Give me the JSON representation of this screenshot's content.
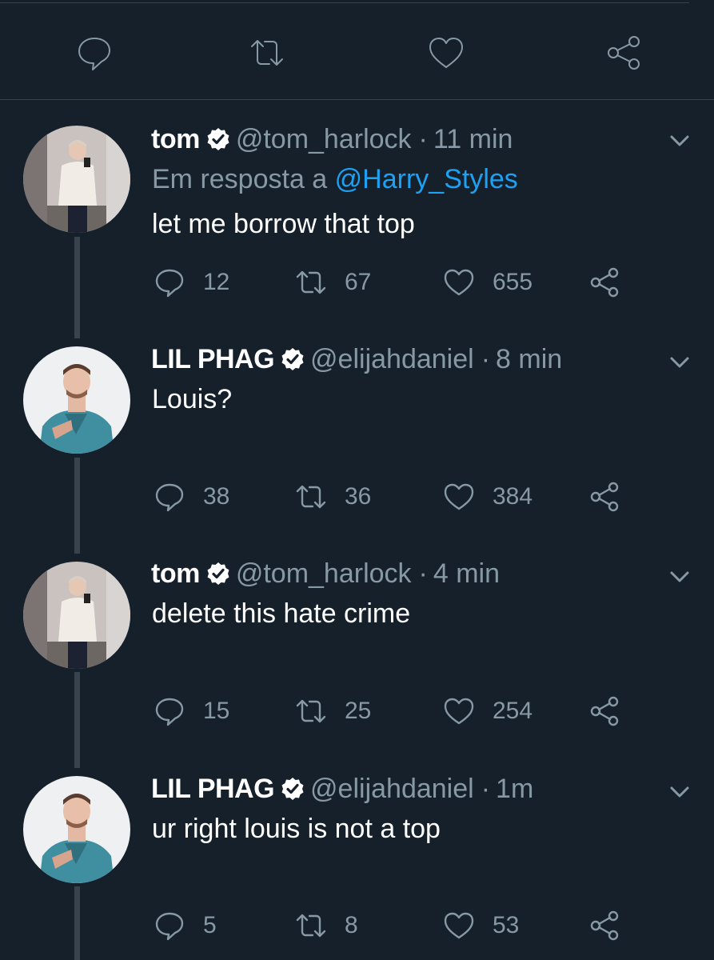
{
  "tweets": [
    {
      "name": "tom",
      "handle": "@tom_harlock",
      "separator": "·",
      "time": "11 min",
      "reply_prefix": "Em resposta a",
      "reply_to": "@Harry_Styles",
      "text": "let me borrow that top",
      "replies": "12",
      "retweets": "67",
      "likes": "655"
    },
    {
      "name": "LIL PHAG",
      "handle": "@elijahdaniel",
      "separator": "·",
      "time": "8 min",
      "text": "Louis?",
      "replies": "38",
      "retweets": "36",
      "likes": "384"
    },
    {
      "name": "tom",
      "handle": "@tom_harlock",
      "separator": "·",
      "time": "4 min",
      "text": "delete this hate crime",
      "replies": "15",
      "retweets": "25",
      "likes": "254"
    },
    {
      "name": "LIL PHAG",
      "handle": "@elijahdaniel",
      "separator": "·",
      "time": "1m",
      "text": "ur right louis is not a top",
      "replies": "5",
      "retweets": "8",
      "likes": "53"
    }
  ],
  "colors": {
    "background": "#15202b",
    "text": "#ffffff",
    "secondary": "#8899a6",
    "link": "#1da1f2",
    "divider": "#38444d",
    "verified_badge": "#ffffff"
  },
  "icons": {
    "reply": "speech-bubble-icon",
    "retweet": "retweet-icon",
    "like": "heart-icon",
    "share": "share-icon",
    "verified": "verified-badge-icon",
    "menu": "chevron-down-icon"
  }
}
